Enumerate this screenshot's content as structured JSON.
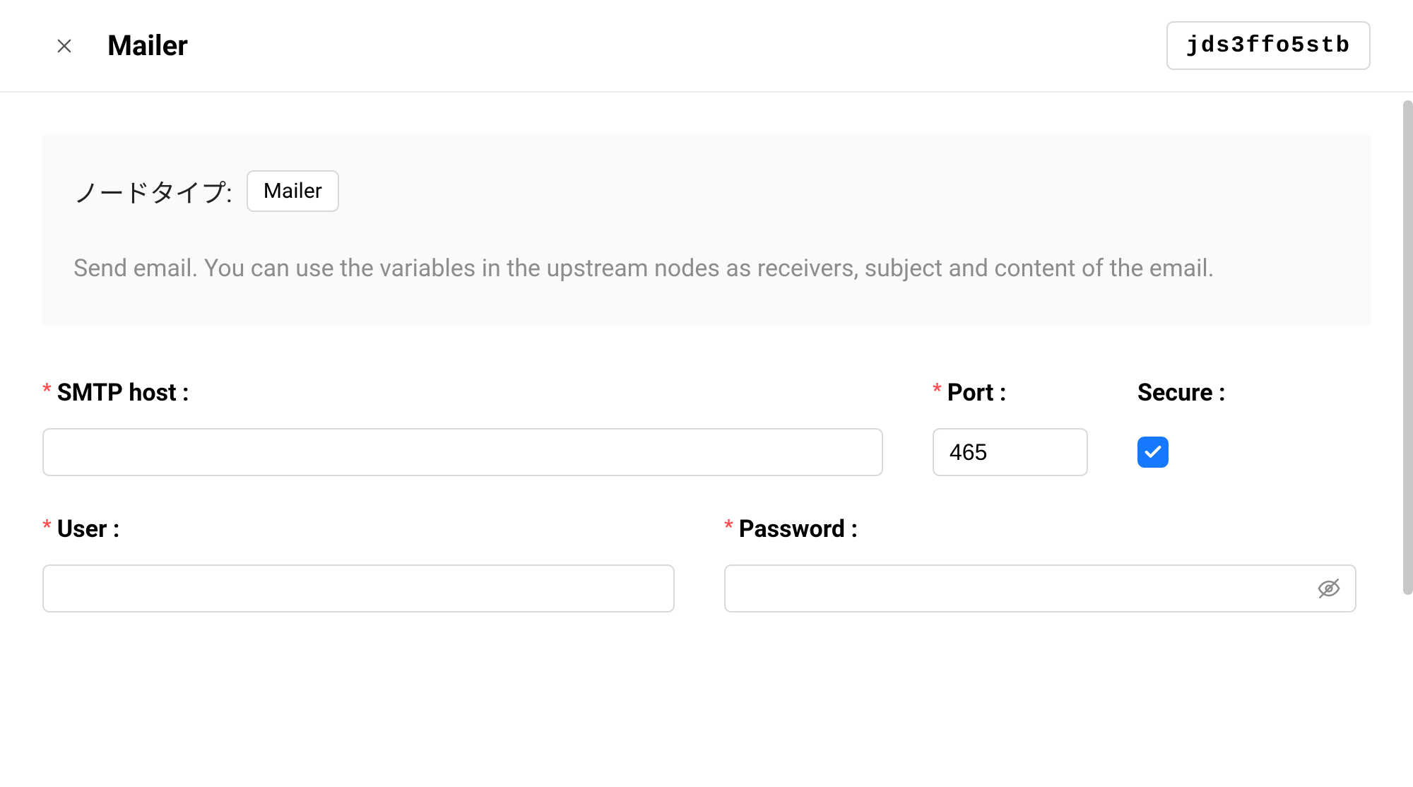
{
  "header": {
    "title": "Mailer",
    "id_badge": "jds3ffo5stb"
  },
  "info": {
    "node_type_label": "ノードタイプ:",
    "node_type_value": "Mailer",
    "description": "Send email. You can use the variables in the upstream nodes as receivers, subject and content of the email."
  },
  "fields": {
    "smtp_host": {
      "label": "SMTP host :",
      "value": ""
    },
    "port": {
      "label": "Port :",
      "value": "465"
    },
    "secure": {
      "label": "Secure :",
      "checked": true
    },
    "user": {
      "label": "User :",
      "value": ""
    },
    "password": {
      "label": "Password :",
      "value": ""
    }
  }
}
